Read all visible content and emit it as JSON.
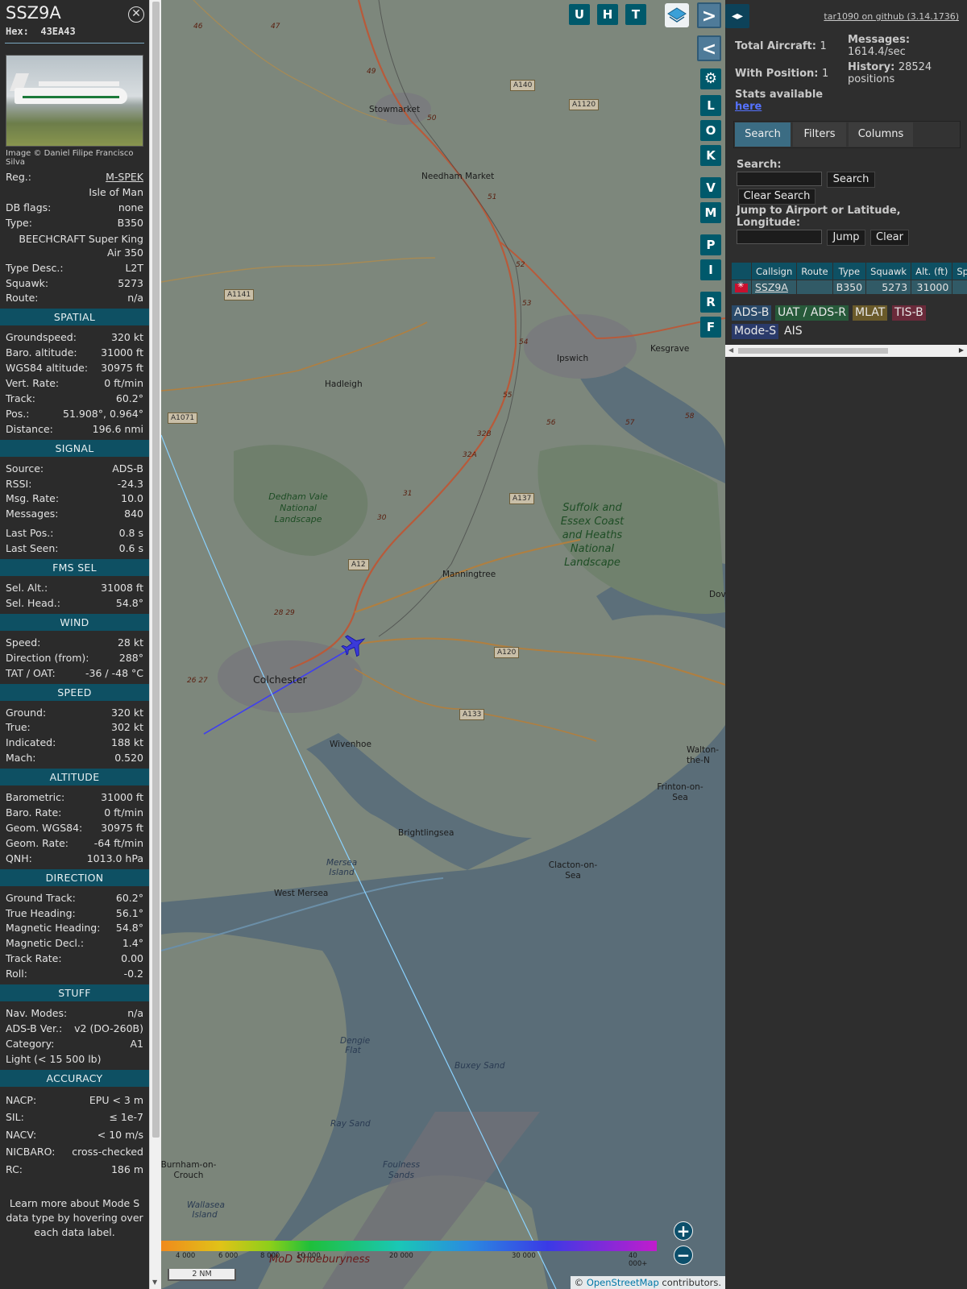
{
  "sidebar": {
    "callsign": "SSZ9A",
    "hex_label": "Hex:",
    "hex": "43EA43",
    "photo_credit": "Image © Daniel Filipe Francisco Silva",
    "info": [
      {
        "k": "Reg.:",
        "v": "M-SPEK"
      },
      {
        "k": "",
        "v": "Isle of Man"
      },
      {
        "k": "DB flags:",
        "v": "none"
      },
      {
        "k": "Type:",
        "v": "B350"
      }
    ],
    "type_full": "BEECHCRAFT Super King Air 350",
    "info2": [
      {
        "k": "Type Desc.:",
        "v": "L2T"
      },
      {
        "k": "Squawk:",
        "v": "5273"
      },
      {
        "k": "Route:",
        "v": "n/a"
      }
    ],
    "sections": {
      "spatial": "SPATIAL",
      "signal": "SIGNAL",
      "fms": "FMS SEL",
      "wind": "WIND",
      "speed": "SPEED",
      "altitude": "ALTITUDE",
      "direction": "DIRECTION",
      "stuff": "STUFF",
      "accuracy": "ACCURACY"
    },
    "spatial": [
      {
        "k": "Groundspeed:",
        "v": "320 kt"
      },
      {
        "k": "Baro. altitude:",
        "v": "31000 ft"
      },
      {
        "k": "WGS84 altitude:",
        "v": "30975 ft"
      },
      {
        "k": "Vert. Rate:",
        "v": "0 ft/min"
      },
      {
        "k": "Track:",
        "v": "60.2°"
      },
      {
        "k": "Pos.:",
        "v": "51.908°, 0.964°"
      },
      {
        "k": "Distance:",
        "v": "196.6 nmi"
      }
    ],
    "signal": [
      {
        "k": "Source:",
        "v": "ADS-B"
      },
      {
        "k": "RSSI:",
        "v": "-24.3"
      },
      {
        "k": "Msg. Rate:",
        "v": "10.0"
      },
      {
        "k": "Messages:",
        "v": "840"
      },
      {
        "k": "Last Pos.:",
        "v": "0.8 s"
      },
      {
        "k": "Last Seen:",
        "v": "0.6 s"
      }
    ],
    "fms": [
      {
        "k": "Sel. Alt.:",
        "v": "31008 ft"
      },
      {
        "k": "Sel. Head.:",
        "v": "54.8°"
      }
    ],
    "wind": [
      {
        "k": "Speed:",
        "v": "28 kt"
      },
      {
        "k": "Direction (from):",
        "v": "288°"
      },
      {
        "k": "TAT / OAT:",
        "v": "-36 / -48 °C"
      }
    ],
    "speed": [
      {
        "k": "Ground:",
        "v": "320 kt"
      },
      {
        "k": "True:",
        "v": "302 kt"
      },
      {
        "k": "Indicated:",
        "v": "188 kt"
      },
      {
        "k": "Mach:",
        "v": "0.520"
      }
    ],
    "altitude": [
      {
        "k": "Barometric:",
        "v": "31000 ft"
      },
      {
        "k": "Baro. Rate:",
        "v": "0 ft/min"
      },
      {
        "k": "Geom. WGS84:",
        "v": "30975 ft"
      },
      {
        "k": "Geom. Rate:",
        "v": "-64 ft/min"
      },
      {
        "k": "QNH:",
        "v": "1013.0 hPa"
      }
    ],
    "direction": [
      {
        "k": "Ground Track:",
        "v": "60.2°"
      },
      {
        "k": "True Heading:",
        "v": "56.1°"
      },
      {
        "k": "Magnetic Heading:",
        "v": "54.8°"
      },
      {
        "k": "Magnetic Decl.:",
        "v": "1.4°"
      },
      {
        "k": "Track Rate:",
        "v": "0.00"
      },
      {
        "k": "Roll:",
        "v": "-0.2"
      }
    ],
    "stuff": [
      {
        "k": "Nav. Modes:",
        "v": "n/a"
      },
      {
        "k": "ADS-B Ver.:",
        "v": "v2 (DO-260B)"
      },
      {
        "k": "Category:",
        "v": "A1"
      }
    ],
    "category_desc": "Light (< 15 500 lb)",
    "accuracy": [
      {
        "k": "NACP:",
        "v": "EPU < 3 m"
      },
      {
        "k": "SIL:",
        "v": "≤ 1e-7"
      },
      {
        "k": "NACV:",
        "v": "< 10 m/s"
      },
      {
        "k": "NICBARO:",
        "v": "cross-checked"
      },
      {
        "k": "RC:",
        "v": "186 m"
      }
    ],
    "footer": "Learn more about Mode S data type by hovering over each data label."
  },
  "map": {
    "buttons_top": [
      "U",
      "H",
      "T"
    ],
    "buttons_side": [
      "L",
      "O",
      "K",
      "V",
      "M",
      "P",
      "I",
      "R",
      "F"
    ],
    "places": [
      {
        "name": "Stowmarket"
      },
      {
        "name": "Needham Market"
      },
      {
        "name": "Ipswich"
      },
      {
        "name": "Kesgrave"
      },
      {
        "name": "Hadleigh"
      },
      {
        "name": "Manningtree"
      },
      {
        "name": "Colchester"
      },
      {
        "name": "Wivenhoe"
      },
      {
        "name": "Brightlingsea"
      },
      {
        "name": "West Mersea"
      },
      {
        "name": "Clacton-on-Sea"
      },
      {
        "name": "Frinton-on-Sea"
      },
      {
        "name": "Walton-the-N"
      },
      {
        "name": "Burnham-on-Crouch"
      },
      {
        "name": "Dove"
      }
    ],
    "italic_places": [
      "Mersea Island",
      "Dengie Flat",
      "Buxey Sand",
      "Ray Sand",
      "Foulness Sands",
      "Wallasea Island",
      "MoD Shoeburyness"
    ],
    "green_areas": [
      "Dedham Vale National Landscape",
      "Suffolk and Essex Coast and Heaths National Landscape"
    ],
    "roads": [
      "A140",
      "A1120",
      "A1141",
      "A1071",
      "A137",
      "A12",
      "A120",
      "A133"
    ],
    "scale_labels": [
      "4 000",
      "6 000",
      "8 000",
      "10 000",
      "20 000",
      "30 000",
      "40 000+"
    ],
    "nm_scale": "2 NM",
    "attribution_prefix": "©",
    "attribution_link": "OpenStreetMap",
    "attribution_suffix": "contributors."
  },
  "panel": {
    "github": "tar1090 on github (3.14.1736)",
    "total_label": "Total Aircraft:",
    "total_value": "1",
    "messages_label": "Messages:",
    "messages_value": "1614.4/sec",
    "withpos_label": "With Position:",
    "withpos_value": "1",
    "history_label": "History:",
    "history_value": "28524 positions",
    "stats_label": "Stats available",
    "stats_link": "here",
    "tabs": [
      "Search",
      "Filters",
      "Columns"
    ],
    "search_label": "Search:",
    "search_button": "Search",
    "clear_search_button": "Clear Search",
    "jump_label": "Jump to Airport or Latitude, Longitude:",
    "jump_button": "Jump",
    "clear_button": "Clear",
    "columns": [
      "Callsign",
      "Route",
      "Type",
      "Squawk",
      "Alt. (ft)",
      "Spd."
    ],
    "row": {
      "callsign": "SSZ9A",
      "route": "",
      "type": "B350",
      "squawk": "5273",
      "alt": "31000",
      "spd": ""
    },
    "sources": [
      "ADS-B",
      "UAT / ADS-R",
      "MLAT",
      "TIS-B",
      "Mode-S",
      "AIS"
    ]
  }
}
